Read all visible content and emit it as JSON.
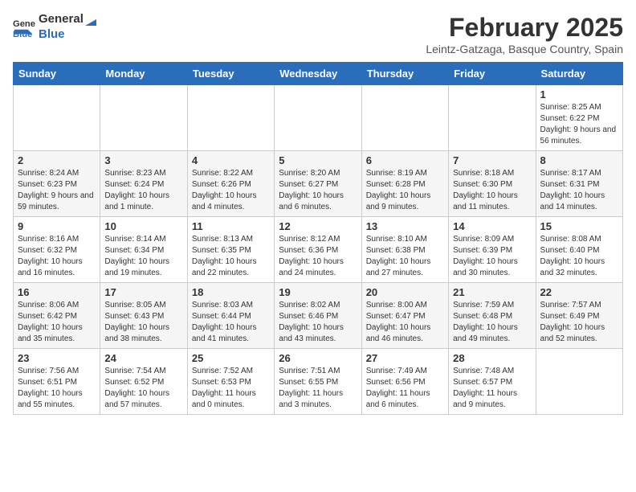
{
  "header": {
    "logo": {
      "general": "General",
      "blue": "Blue"
    },
    "title": "February 2025",
    "location": "Leintz-Gatzaga, Basque Country, Spain"
  },
  "weekdays": [
    "Sunday",
    "Monday",
    "Tuesday",
    "Wednesday",
    "Thursday",
    "Friday",
    "Saturday"
  ],
  "weeks": [
    [
      {
        "day": null
      },
      {
        "day": null
      },
      {
        "day": null
      },
      {
        "day": null
      },
      {
        "day": null
      },
      {
        "day": null
      },
      {
        "day": "1",
        "sunrise": "8:25 AM",
        "sunset": "6:22 PM",
        "daylight": "9 hours and 56 minutes."
      }
    ],
    [
      {
        "day": "2",
        "sunrise": "8:24 AM",
        "sunset": "6:23 PM",
        "daylight": "9 hours and 59 minutes."
      },
      {
        "day": "3",
        "sunrise": "8:23 AM",
        "sunset": "6:24 PM",
        "daylight": "10 hours and 1 minute."
      },
      {
        "day": "4",
        "sunrise": "8:22 AM",
        "sunset": "6:26 PM",
        "daylight": "10 hours and 4 minutes."
      },
      {
        "day": "5",
        "sunrise": "8:20 AM",
        "sunset": "6:27 PM",
        "daylight": "10 hours and 6 minutes."
      },
      {
        "day": "6",
        "sunrise": "8:19 AM",
        "sunset": "6:28 PM",
        "daylight": "10 hours and 9 minutes."
      },
      {
        "day": "7",
        "sunrise": "8:18 AM",
        "sunset": "6:30 PM",
        "daylight": "10 hours and 11 minutes."
      },
      {
        "day": "8",
        "sunrise": "8:17 AM",
        "sunset": "6:31 PM",
        "daylight": "10 hours and 14 minutes."
      }
    ],
    [
      {
        "day": "9",
        "sunrise": "8:16 AM",
        "sunset": "6:32 PM",
        "daylight": "10 hours and 16 minutes."
      },
      {
        "day": "10",
        "sunrise": "8:14 AM",
        "sunset": "6:34 PM",
        "daylight": "10 hours and 19 minutes."
      },
      {
        "day": "11",
        "sunrise": "8:13 AM",
        "sunset": "6:35 PM",
        "daylight": "10 hours and 22 minutes."
      },
      {
        "day": "12",
        "sunrise": "8:12 AM",
        "sunset": "6:36 PM",
        "daylight": "10 hours and 24 minutes."
      },
      {
        "day": "13",
        "sunrise": "8:10 AM",
        "sunset": "6:38 PM",
        "daylight": "10 hours and 27 minutes."
      },
      {
        "day": "14",
        "sunrise": "8:09 AM",
        "sunset": "6:39 PM",
        "daylight": "10 hours and 30 minutes."
      },
      {
        "day": "15",
        "sunrise": "8:08 AM",
        "sunset": "6:40 PM",
        "daylight": "10 hours and 32 minutes."
      }
    ],
    [
      {
        "day": "16",
        "sunrise": "8:06 AM",
        "sunset": "6:42 PM",
        "daylight": "10 hours and 35 minutes."
      },
      {
        "day": "17",
        "sunrise": "8:05 AM",
        "sunset": "6:43 PM",
        "daylight": "10 hours and 38 minutes."
      },
      {
        "day": "18",
        "sunrise": "8:03 AM",
        "sunset": "6:44 PM",
        "daylight": "10 hours and 41 minutes."
      },
      {
        "day": "19",
        "sunrise": "8:02 AM",
        "sunset": "6:46 PM",
        "daylight": "10 hours and 43 minutes."
      },
      {
        "day": "20",
        "sunrise": "8:00 AM",
        "sunset": "6:47 PM",
        "daylight": "10 hours and 46 minutes."
      },
      {
        "day": "21",
        "sunrise": "7:59 AM",
        "sunset": "6:48 PM",
        "daylight": "10 hours and 49 minutes."
      },
      {
        "day": "22",
        "sunrise": "7:57 AM",
        "sunset": "6:49 PM",
        "daylight": "10 hours and 52 minutes."
      }
    ],
    [
      {
        "day": "23",
        "sunrise": "7:56 AM",
        "sunset": "6:51 PM",
        "daylight": "10 hours and 55 minutes."
      },
      {
        "day": "24",
        "sunrise": "7:54 AM",
        "sunset": "6:52 PM",
        "daylight": "10 hours and 57 minutes."
      },
      {
        "day": "25",
        "sunrise": "7:52 AM",
        "sunset": "6:53 PM",
        "daylight": "11 hours and 0 minutes."
      },
      {
        "day": "26",
        "sunrise": "7:51 AM",
        "sunset": "6:55 PM",
        "daylight": "11 hours and 3 minutes."
      },
      {
        "day": "27",
        "sunrise": "7:49 AM",
        "sunset": "6:56 PM",
        "daylight": "11 hours and 6 minutes."
      },
      {
        "day": "28",
        "sunrise": "7:48 AM",
        "sunset": "6:57 PM",
        "daylight": "11 hours and 9 minutes."
      },
      {
        "day": null
      }
    ]
  ]
}
